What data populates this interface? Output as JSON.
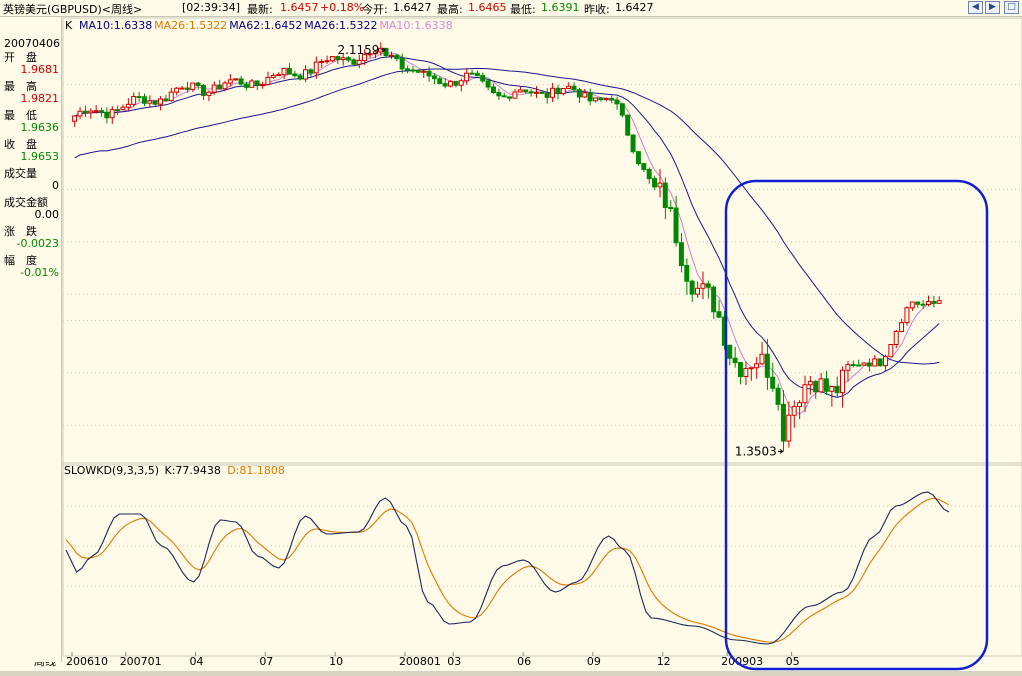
{
  "window": {
    "title": "英镑美元(GBPUSD)<周线>",
    "time": "[02:39:34]",
    "latest_label": "最新:",
    "latest_value": "1.6457",
    "change_pct": "+0.18%",
    "open_label": "今开:",
    "open_value": "1.6427",
    "high_label": "最高:",
    "high_value": "1.6465",
    "low_label": "最低:",
    "low_value": "1.6391",
    "prev_close_label": "昨收:",
    "prev_close_value": "1.6427"
  },
  "info_panel": {
    "date": "20070406",
    "rows": [
      {
        "label": "开　盘",
        "value": "1.9681",
        "color": "#d40000"
      },
      {
        "label": "最　高",
        "value": "1.9821",
        "color": "#d40000"
      },
      {
        "label": "最　低",
        "value": "1.9636",
        "color": "#008800"
      },
      {
        "label": "收　盘",
        "value": "1.9653",
        "color": "#008800"
      },
      {
        "label": "成交量",
        "value": "0",
        "color": "#000000"
      },
      {
        "label": "成交金额",
        "value": "0.00",
        "color": "#000000"
      },
      {
        "label": "涨　跌",
        "value": "-0.0023",
        "color": "#008800"
      },
      {
        "label": "幅　度",
        "value": "-0.01%",
        "color": "#008800"
      }
    ]
  },
  "chart_data": [
    {
      "type": "candlestick",
      "legend_prefix": "K",
      "legend": [
        {
          "text": "MA10:1.6338",
          "color": "#000080"
        },
        {
          "text": "MA26:1.5322",
          "color": "#e07800"
        },
        {
          "text": "MA62:1.6452",
          "color": "#000080"
        },
        {
          "text": "MA26:1.5322",
          "color": "#000080"
        },
        {
          "text": "MA10:1.6338",
          "color": "#d888d8"
        }
      ],
      "y_ticks": [
        "1.6",
        "1.5",
        "1.4"
      ],
      "y_tick_values": [
        1.6,
        1.5,
        1.4
      ],
      "price_range": [
        1.33,
        2.15
      ],
      "annotations": [
        {
          "text": "2.1159",
          "value": 2.1159,
          "bar": 58
        },
        {
          "text": "1.3503",
          "value": 1.3503,
          "bar": 132
        }
      ],
      "colors": {
        "up": "#d40000",
        "down": "#008800",
        "ma_short": "#d080d0",
        "ma_mid": "#1a1a8c",
        "ma_long": "#1a1a8c"
      }
    },
    {
      "type": "line",
      "legend": [
        {
          "text": "SLOWKD(9,3,3,5)",
          "color": "#000000"
        },
        {
          "text": "K:77.9438",
          "color": "#000000"
        },
        {
          "text": "D:81.1808",
          "color": "#e07800"
        }
      ],
      "y_ticks": [
        "80",
        "60",
        "40"
      ],
      "y_tick_values": [
        80,
        60,
        40
      ],
      "y_range": [
        8,
        95
      ],
      "series_colors": {
        "k": "#1a2a5a",
        "d": "#e07800"
      }
    }
  ],
  "x_axis": {
    "prefix": "周线",
    "labels": [
      "200610",
      "200701",
      "04",
      "07",
      "10",
      "200801",
      "03",
      "06",
      "09",
      "12",
      "200903",
      "05"
    ],
    "label_bars": [
      0,
      10,
      23,
      36,
      49,
      62,
      71,
      84,
      97,
      110,
      122,
      134
    ]
  },
  "highlight_box": {
    "color": "#1020d0"
  }
}
